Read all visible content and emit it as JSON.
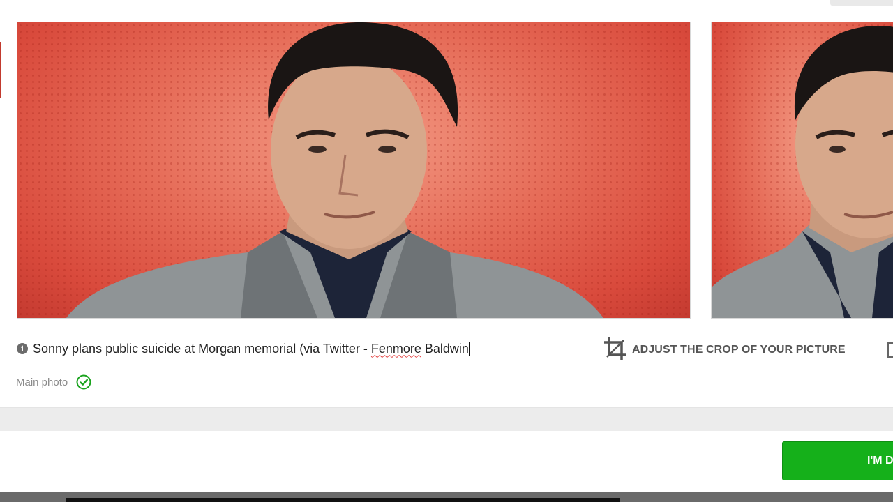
{
  "photo_editor": {
    "main_image": {
      "description_icon": "portrait-photo"
    },
    "secondary_image": {
      "description_icon": "portrait-photo"
    },
    "caption": {
      "info_icon": "info-icon",
      "text_before": "Sonny plans public suicide at Morgan memorial (via Twitter - ",
      "misspelled_word": "Fenmore",
      "text_after": " Baldwin"
    },
    "crop_action": {
      "icon": "crop-icon",
      "label": "ADJUST THE CROP OF YOUR PICTURE"
    },
    "main_photo": {
      "label": "Main photo",
      "status_icon": "check-circle-icon",
      "status_color": "#1aa31e"
    }
  },
  "footer": {
    "done_button_label": "I'M DONE",
    "done_button_color": "#15b01a"
  }
}
